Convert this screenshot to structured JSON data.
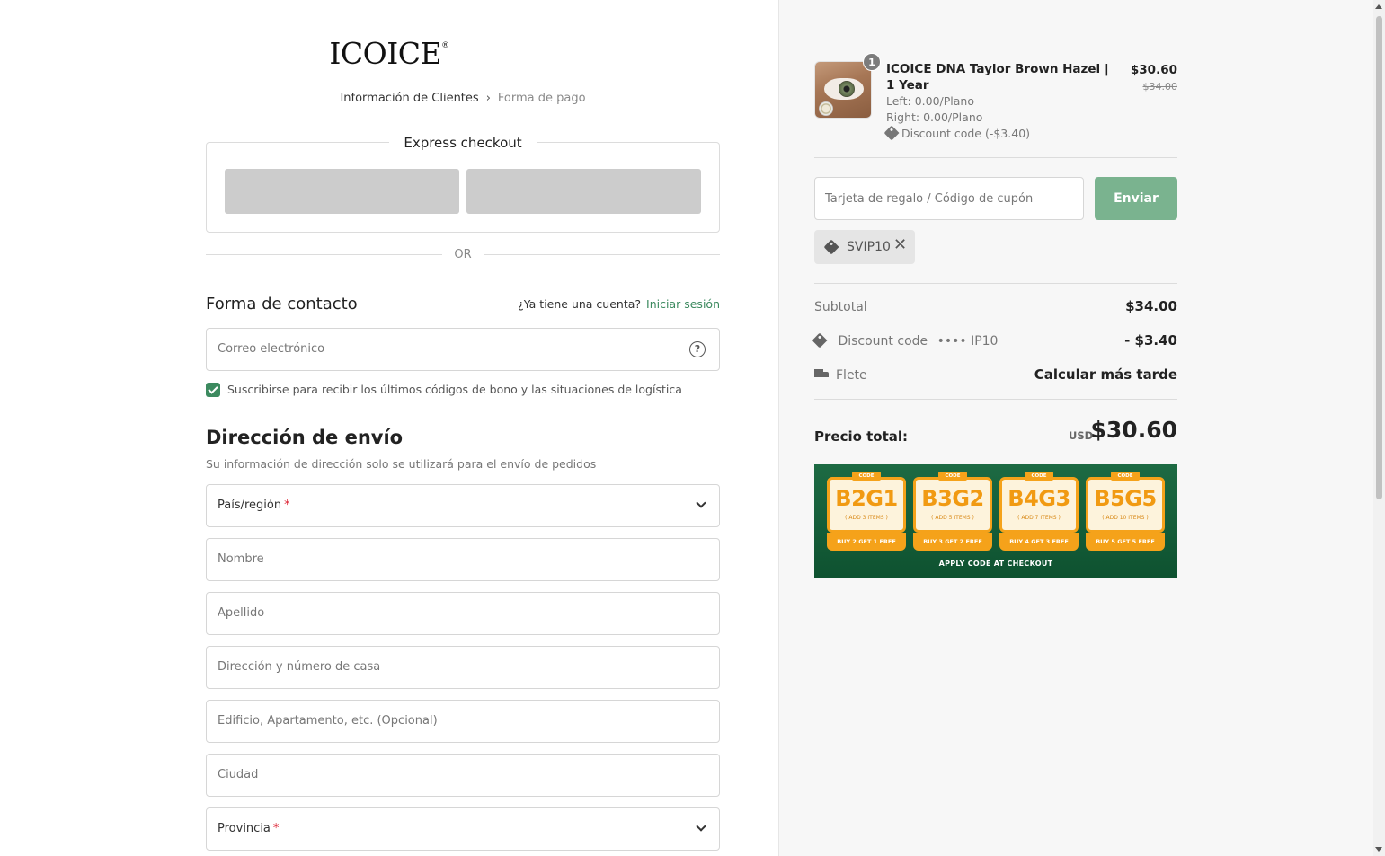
{
  "brand": {
    "name": "ICOICE",
    "reg": "®"
  },
  "breadcrumb": {
    "step1": "Información de Clientes",
    "step2": "Forma de pago"
  },
  "express": {
    "title": "Express checkout",
    "or": "OR"
  },
  "contact": {
    "title": "Forma de contacto",
    "account_question": "¿Ya tiene una cuenta?",
    "login_link": "Iniciar sesión",
    "email_placeholder": "Correo electrónico",
    "subscribe_label": "Suscribirse para recibir los últimos códigos de bono y las situaciones de logística",
    "subscribe_checked": true
  },
  "shipping": {
    "title": "Dirección de envío",
    "description": "Su información de dirección solo se utilizará para el envío de pedidos",
    "country_label": "País/región",
    "first_name": "Nombre",
    "last_name": "Apellido",
    "address": "Dirección y número de casa",
    "address2": "Edificio, Apartamento, etc. (Opcional)",
    "city": "Ciudad",
    "province_label": "Provincia",
    "required_mark": "*"
  },
  "cart": {
    "item": {
      "quantity": "1",
      "name": "ICOICE DNA Taylor Brown Hazel | 1 Year",
      "left": "Left: 0.00/Plano",
      "right": "Right: 0.00/Plano",
      "discount": "Discount code (-$3.40)",
      "price": "$30.60",
      "original_price": "$34.00"
    },
    "coupon_placeholder": "Tarjeta de regalo / Código de cupón",
    "send_button": "Enviar",
    "applied_code": "SVIP10",
    "summary": {
      "subtotal_label": "Subtotal",
      "subtotal_value": "$34.00",
      "discount_label": "Discount code",
      "discount_code_masked": "•••• IP10",
      "discount_value": "- $3.40",
      "shipping_label": "Flete",
      "shipping_value": "Calcular más tarde",
      "total_label": "Precio total:",
      "total_currency": "USD",
      "total_value": "$30.60"
    }
  },
  "promo_banner": {
    "tickets": [
      {
        "label": "CODE",
        "code": "B2G1",
        "add": "( ADD 3 ITEMS )",
        "offer": "BUY 2 GET 1 FREE"
      },
      {
        "label": "CODE",
        "code": "B3G2",
        "add": "( ADD 5 ITEMS )",
        "offer": "BUY 3 GET 2 FREE"
      },
      {
        "label": "CODE",
        "code": "B4G3",
        "add": "( ADD 7 ITEMS )",
        "offer": "BUY 4 GET 3 FREE"
      },
      {
        "label": "CODE",
        "code": "B5G5",
        "add": "( ADD 10 ITEMS )",
        "offer": "BUY 5 GET 5 FREE"
      }
    ],
    "footer": "APPLY CODE AT CHECKOUT"
  },
  "colors": {
    "accent_green": "#3c8a5f",
    "send_button": "#7ab38f",
    "banner_green": "#1d6a43",
    "ticket_orange": "#f5a21a"
  }
}
